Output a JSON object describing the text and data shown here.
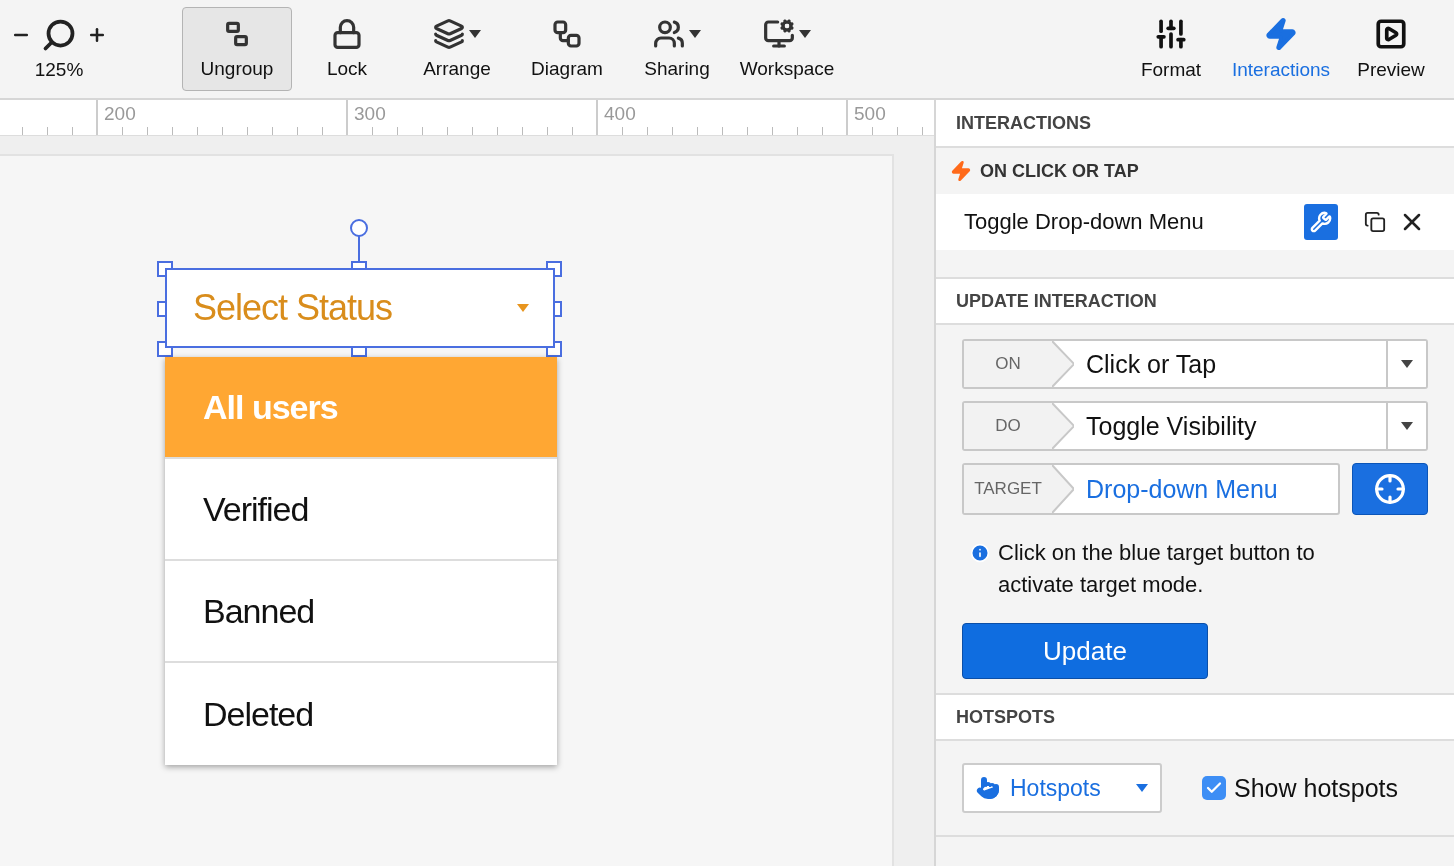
{
  "toolbar": {
    "zoom": {
      "label": "125%"
    },
    "tools": [
      {
        "label": "Ungroup",
        "kind": "ungroup",
        "selected": true,
        "has_menu": false
      },
      {
        "label": "Lock",
        "kind": "lock",
        "selected": false,
        "has_menu": false
      },
      {
        "label": "Arrange",
        "kind": "arrange",
        "selected": false,
        "has_menu": true
      },
      {
        "label": "Diagram",
        "kind": "diagram",
        "selected": false,
        "has_menu": false
      },
      {
        "label": "Sharing",
        "kind": "sharing",
        "selected": false,
        "has_menu": true
      },
      {
        "label": "Workspace",
        "kind": "workspace",
        "selected": false,
        "has_menu": true
      }
    ],
    "view_tabs": [
      {
        "label": "Format",
        "kind": "format",
        "selected": false
      },
      {
        "label": "Interactions",
        "kind": "interactions",
        "selected": true
      },
      {
        "label": "Preview",
        "kind": "preview",
        "selected": false
      }
    ]
  },
  "ruler": {
    "labels": [
      "200",
      "300",
      "400",
      "500"
    ]
  },
  "canvas": {
    "select": {
      "label": "Select Status",
      "selected": true
    },
    "menu_items": [
      {
        "label": "All users",
        "selected": true
      },
      {
        "label": "Verified",
        "selected": false
      },
      {
        "label": "Banned",
        "selected": false
      },
      {
        "label": "Deleted",
        "selected": false
      }
    ]
  },
  "panel": {
    "interactions_title": "INTERACTIONS",
    "trigger": "ON CLICK OR TAP",
    "interaction": "Toggle Drop-down Menu",
    "update_title": "UPDATE INTERACTION",
    "fields": [
      {
        "label": "ON",
        "value": "Click or Tap",
        "kind": "dropdown"
      },
      {
        "label": "DO",
        "value": "Toggle Visibility",
        "kind": "dropdown"
      },
      {
        "label": "TARGET",
        "value": "Drop-down Menu",
        "kind": "target"
      }
    ],
    "hint": "Click on the blue target button to activate target mode.",
    "update_button": "Update",
    "hotspots_title": "HOTSPOTS",
    "hotspots_dropdown": "Hotspots",
    "show_hotspots": {
      "label": "Show hotspots",
      "checked": true
    }
  }
}
